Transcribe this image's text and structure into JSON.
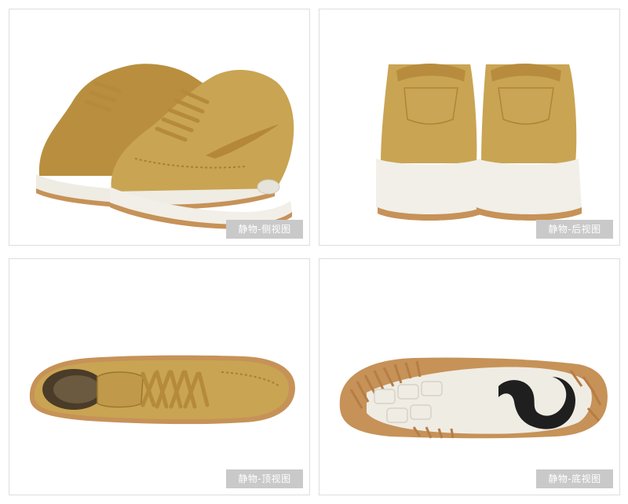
{
  "gallery": {
    "panels": [
      {
        "caption": "静物-侧视图"
      },
      {
        "caption": "静物-后视图"
      },
      {
        "caption": "静物-顶视图"
      },
      {
        "caption": "静物-底视图"
      }
    ]
  },
  "colors": {
    "suede": "#c9a453",
    "suede_dark": "#a77f33",
    "midsole": "#f1efe8",
    "gum": "#c69258",
    "caption_bg": "#c9c9c9"
  }
}
